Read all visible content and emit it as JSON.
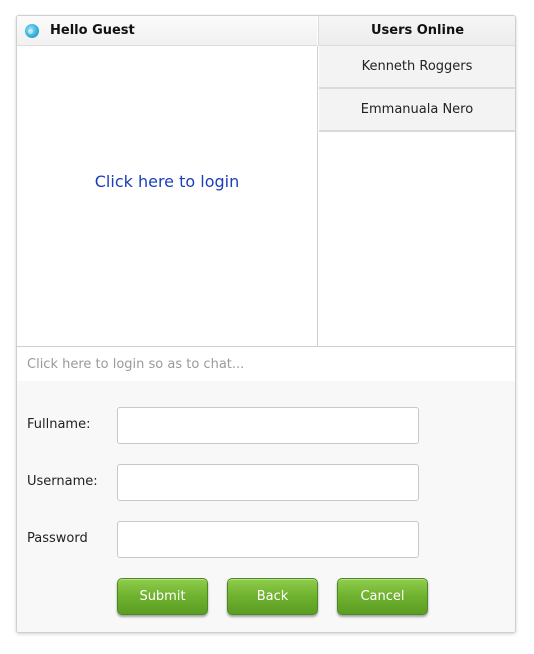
{
  "chat": {
    "header_title": "Hello Guest",
    "header_icon": "globe-icon",
    "login_link": "Click here to login",
    "message_placeholder": "Click here to login so as to chat..."
  },
  "users": {
    "header": "Users Online",
    "items": [
      {
        "name": "Kenneth Roggers"
      },
      {
        "name": "Emmanuala Nero"
      }
    ]
  },
  "form": {
    "fullname_label": "Fullname:",
    "fullname_value": "",
    "username_label": "Username:",
    "username_value": "",
    "password_label": "Password",
    "password_value": ""
  },
  "buttons": {
    "submit": "Submit",
    "back": "Back",
    "cancel": "Cancel"
  },
  "colors": {
    "link": "#1a3fb8",
    "button_green": "#6fb12f"
  }
}
